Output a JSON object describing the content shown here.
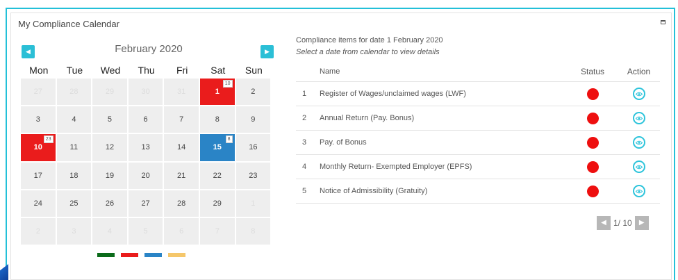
{
  "card": {
    "title": "My Compliance Calendar"
  },
  "calendar": {
    "month_label": "February 2020",
    "weekdays": [
      "Mon",
      "Tue",
      "Wed",
      "Thu",
      "Fri",
      "Sat",
      "Sun"
    ],
    "days": [
      {
        "d": "27",
        "muted": true
      },
      {
        "d": "28",
        "muted": true
      },
      {
        "d": "29",
        "muted": true
      },
      {
        "d": "30",
        "muted": true
      },
      {
        "d": "31",
        "muted": true
      },
      {
        "d": "1",
        "color": "red",
        "badge": "10"
      },
      {
        "d": "2"
      },
      {
        "d": "3"
      },
      {
        "d": "4"
      },
      {
        "d": "5"
      },
      {
        "d": "6"
      },
      {
        "d": "7"
      },
      {
        "d": "8"
      },
      {
        "d": "9"
      },
      {
        "d": "10",
        "color": "red",
        "badge": "23"
      },
      {
        "d": "11"
      },
      {
        "d": "12"
      },
      {
        "d": "13"
      },
      {
        "d": "14"
      },
      {
        "d": "15",
        "color": "blue",
        "badge": "8"
      },
      {
        "d": "16"
      },
      {
        "d": "17"
      },
      {
        "d": "18"
      },
      {
        "d": "19"
      },
      {
        "d": "20"
      },
      {
        "d": "21"
      },
      {
        "d": "22"
      },
      {
        "d": "23"
      },
      {
        "d": "24"
      },
      {
        "d": "25"
      },
      {
        "d": "26"
      },
      {
        "d": "27"
      },
      {
        "d": "28"
      },
      {
        "d": "29"
      },
      {
        "d": "1",
        "muted": true
      },
      {
        "d": "2",
        "muted": true
      },
      {
        "d": "3",
        "muted": true
      },
      {
        "d": "4",
        "muted": true
      },
      {
        "d": "5",
        "muted": true
      },
      {
        "d": "6",
        "muted": true
      },
      {
        "d": "7",
        "muted": true
      },
      {
        "d": "8",
        "muted": true
      }
    ],
    "legend_colors": [
      "#0b6b1a",
      "#ea1c1c",
      "#2a84c6",
      "#f5c76b"
    ]
  },
  "compliance": {
    "title": "Compliance items for date 1 February 2020",
    "subtitle": "Select a date from calendar to view details",
    "headers": {
      "name": "Name",
      "status": "Status",
      "action": "Action"
    },
    "items": [
      {
        "num": "1",
        "name": "Register of Wages/unclaimed wages (LWF)"
      },
      {
        "num": "2",
        "name": "Annual Return (Pay. Bonus)"
      },
      {
        "num": "3",
        "name": "Pay. of Bonus"
      },
      {
        "num": "4",
        "name": "Monthly Return- Exempted Employer (EPFS)"
      },
      {
        "num": "5",
        "name": "Notice of Admissibility (Gratuity)"
      }
    ],
    "status_color": "#ee0f0f",
    "pagination": "1/ 10"
  },
  "icons": {
    "prev": "chevron-left-icon",
    "next": "chevron-right-icon",
    "view": "eye-icon",
    "maximize": "maximize-icon"
  }
}
